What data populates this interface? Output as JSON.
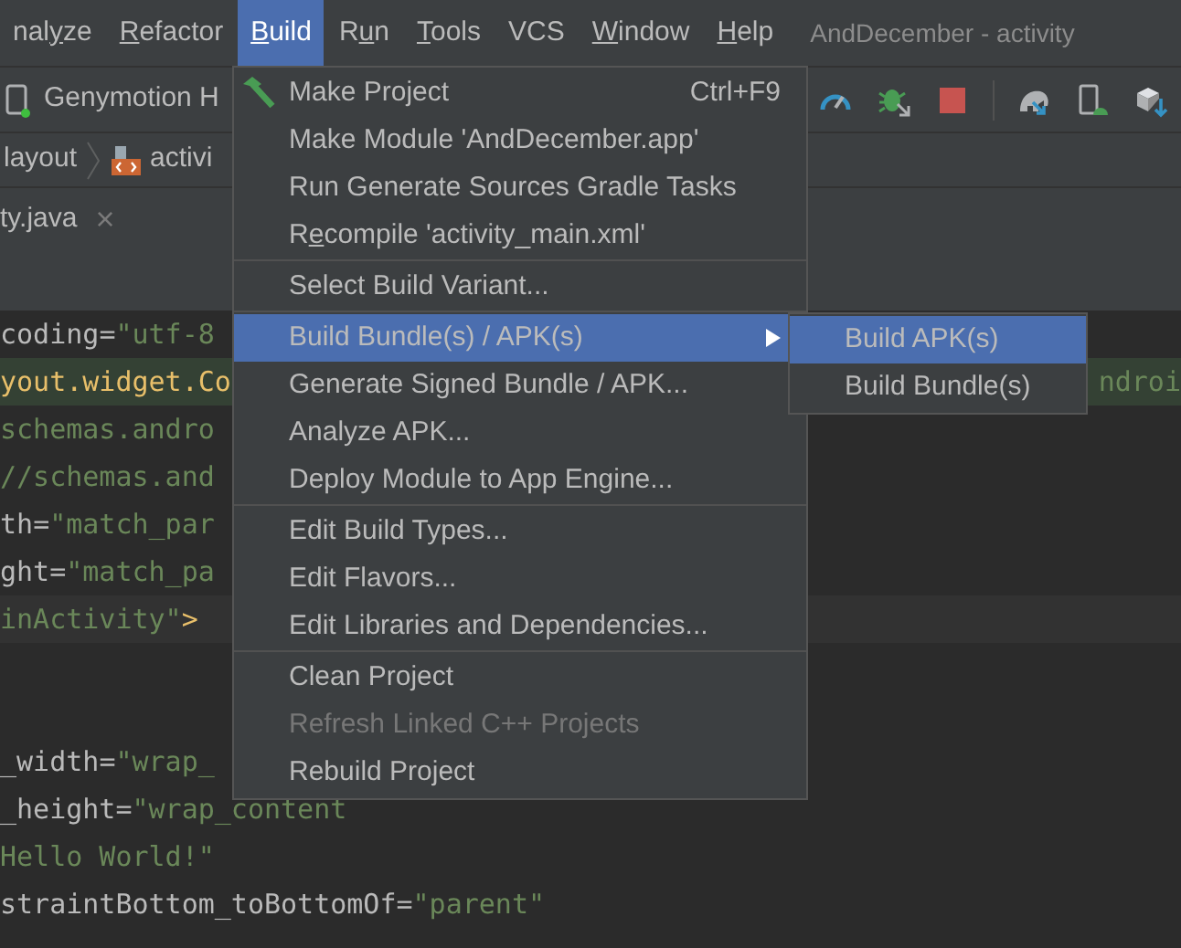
{
  "menu_bar": {
    "items": [
      {
        "before": "nal",
        "key": "y",
        "after": "ze",
        "selected": false
      },
      {
        "key": "R",
        "after": "efactor",
        "selected": false
      },
      {
        "key": "B",
        "after": "uild",
        "selected": true
      },
      {
        "before": "R",
        "key": "u",
        "after": "n",
        "selected": false
      },
      {
        "key": "T",
        "after": "ools",
        "selected": false
      },
      {
        "before": "VCS",
        "selected": false
      },
      {
        "key": "W",
        "after": "indow",
        "selected": false
      },
      {
        "key": "H",
        "after": "elp",
        "selected": false
      }
    ],
    "title": "AndDecember - activity"
  },
  "toolbar": {
    "device": "Genymotion H"
  },
  "breadcrumb": [
    "layout",
    "activi"
  ],
  "tab": {
    "label": "ty.java",
    "close": "×"
  },
  "editor": {
    "lines": [
      {
        "kind": "code",
        "segments": [
          {
            "kind": "attr",
            "text": "coding"
          },
          {
            "kind": "punct",
            "text": "="
          },
          {
            "kind": "string",
            "text": "\"utf-8"
          }
        ]
      },
      {
        "kind": "matched",
        "segments": [
          {
            "kind": "tag",
            "text": "yout.widget.Co"
          },
          {
            "kind": "right",
            "text": "ndroi"
          }
        ]
      },
      {
        "kind": "code",
        "segments": [
          {
            "kind": "string",
            "text": "schemas.andro"
          }
        ]
      },
      {
        "kind": "code",
        "segments": [
          {
            "kind": "string",
            "text": "//schemas.and"
          }
        ]
      },
      {
        "kind": "code",
        "segments": [
          {
            "kind": "attr",
            "text": "th"
          },
          {
            "kind": "punct",
            "text": "="
          },
          {
            "kind": "string",
            "text": "\"match_par"
          }
        ]
      },
      {
        "kind": "code",
        "segments": [
          {
            "kind": "attr",
            "text": "ght"
          },
          {
            "kind": "punct",
            "text": "="
          },
          {
            "kind": "string",
            "text": "\"match_pa"
          }
        ]
      },
      {
        "kind": "caret",
        "segments": [
          {
            "kind": "string",
            "text": "inActivity\""
          },
          {
            "kind": "tag",
            "text": ">"
          }
        ]
      },
      {
        "kind": "blank"
      },
      {
        "kind": "blank"
      },
      {
        "kind": "code",
        "segments": [
          {
            "kind": "attr",
            "text": "_width"
          },
          {
            "kind": "punct",
            "text": "="
          },
          {
            "kind": "string",
            "text": "\"wrap_"
          }
        ]
      },
      {
        "kind": "code",
        "segments": [
          {
            "kind": "attr",
            "text": "_height"
          },
          {
            "kind": "punct",
            "text": "="
          },
          {
            "kind": "string",
            "text": "\"wrap_content"
          }
        ]
      },
      {
        "kind": "code",
        "segments": [
          {
            "kind": "string",
            "text": "Hello World!\""
          }
        ]
      },
      {
        "kind": "code",
        "segments": [
          {
            "kind": "attr",
            "text": "straintBottom_toBottomOf"
          },
          {
            "kind": "punct",
            "text": "="
          },
          {
            "kind": "string",
            "text": "\"parent\""
          }
        ]
      }
    ]
  },
  "build_menu": {
    "groups": [
      [
        {
          "before": "Make Project",
          "shortcut": "Ctrl+F9",
          "selected": false,
          "disabled": false
        },
        {
          "label": "Make Module 'AndDecember.app'",
          "selected": false,
          "disabled": false
        },
        {
          "label": "Run Generate Sources Gradle Tasks",
          "selected": false,
          "disabled": false
        },
        {
          "before": "R",
          "key": "e",
          "after": "compile 'activity_main.xml'",
          "selected": false,
          "disabled": false
        }
      ],
      [
        {
          "label": "Select Build Variant...",
          "selected": false,
          "disabled": false
        }
      ],
      [
        {
          "label": "Build Bundle(s) / APK(s)",
          "selected": true,
          "disabled": false,
          "submenu": true
        },
        {
          "label": "Generate Signed Bundle / APK...",
          "selected": false,
          "disabled": false
        },
        {
          "label": "Analyze APK...",
          "selected": false,
          "disabled": false
        },
        {
          "label": "Deploy Module to App Engine...",
          "selected": false,
          "disabled": false
        }
      ],
      [
        {
          "label": "Edit Build Types...",
          "selected": false,
          "disabled": false
        },
        {
          "label": "Edit Flavors...",
          "selected": false,
          "disabled": false
        },
        {
          "label": "Edit Libraries and Dependencies...",
          "selected": false,
          "disabled": false
        }
      ],
      [
        {
          "label": "Clean Project",
          "selected": false,
          "disabled": false
        },
        {
          "label": "Refresh Linked C++ Projects",
          "selected": false,
          "disabled": true
        },
        {
          "label": "Rebuild Project",
          "selected": false,
          "disabled": false
        }
      ]
    ]
  },
  "submenu": {
    "items": [
      {
        "label": "Build APK(s)",
        "selected": true
      },
      {
        "label": "Build Bundle(s)",
        "selected": false
      }
    ]
  }
}
